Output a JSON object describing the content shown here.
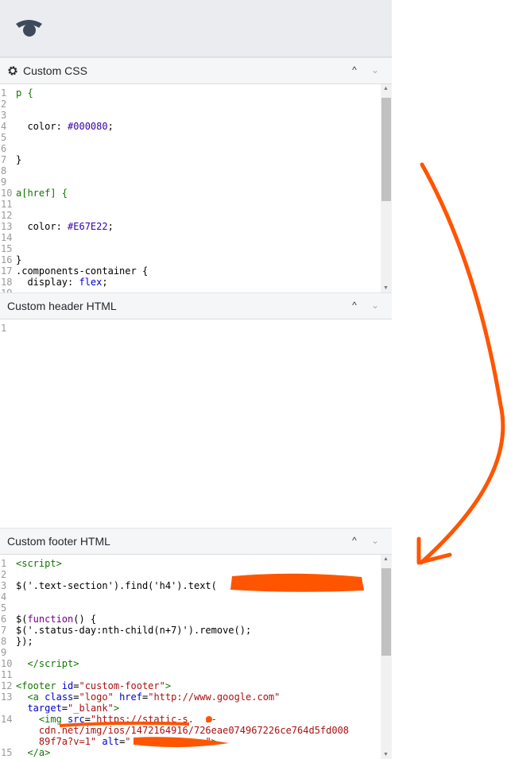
{
  "sections": [
    {
      "title": "Custom CSS",
      "icon": "gear-icon",
      "lines": [
        [
          [
            "p {",
            "t-sel"
          ]
        ],
        [],
        [],
        [
          [
            "  color: ",
            "t-prop"
          ],
          [
            "#000080",
            "t-num"
          ],
          [
            ";",
            "t-txt"
          ]
        ],
        [],
        [],
        [
          [
            "}",
            "t-txt"
          ]
        ],
        [],
        [],
        [
          [
            "a[href] {",
            "t-sel"
          ]
        ],
        [],
        [],
        [
          [
            "  color: ",
            "t-prop"
          ],
          [
            "#E67E22",
            "t-num"
          ],
          [
            ";",
            "t-txt"
          ]
        ],
        [],
        [],
        [
          [
            "}",
            "t-txt"
          ]
        ],
        [
          [
            ".components-container {",
            "t-txt"
          ]
        ],
        [
          [
            "  display: ",
            "t-prop"
          ],
          [
            "flex",
            "t-attr"
          ],
          [
            ";",
            "t-txt"
          ]
        ],
        []
      ]
    },
    {
      "title": "Custom header HTML",
      "lines": [
        []
      ]
    },
    {
      "title": "Custom footer HTML",
      "lines": [
        [
          [
            "<script>",
            "t-tag"
          ]
        ],
        [],
        [
          [
            "$('.text-section').find('h4').text(                        )",
            "t-txt"
          ]
        ],
        [],
        [],
        [
          [
            "$(",
            "t-txt"
          ],
          [
            "function",
            "t-kw"
          ],
          [
            "() {",
            "t-txt"
          ]
        ],
        [
          [
            "$('.status-day:nth-child(n+7)').remove();",
            "t-txt"
          ]
        ],
        [
          [
            "});",
            "t-txt"
          ]
        ],
        [],
        [
          [
            "  </script>",
            "t-tag"
          ]
        ],
        [],
        [
          [
            "<footer ",
            "t-tag"
          ],
          [
            "id",
            "t-attr"
          ],
          [
            "=",
            "t-txt"
          ],
          [
            "\"custom-footer\"",
            "t-str"
          ],
          [
            ">",
            "t-tag"
          ]
        ],
        [
          [
            "  <a ",
            "t-tag"
          ],
          [
            "class",
            "t-attr"
          ],
          [
            "=",
            "t-txt"
          ],
          [
            "\"logo\"",
            "t-str"
          ],
          [
            " href",
            "t-attr"
          ],
          [
            "=",
            "t-txt"
          ],
          [
            "\"http://www.google.com\"",
            "t-str"
          ],
          [
            "\n  ",
            "t-txt"
          ],
          [
            "target",
            "t-attr"
          ],
          [
            "=",
            "t-txt"
          ],
          [
            "\"_blank\"",
            "t-str"
          ],
          [
            ">",
            "t-tag"
          ]
        ],
        [
          [
            "    <img ",
            "t-tag"
          ],
          [
            "src",
            "t-attr"
          ],
          [
            "=",
            "t-txt"
          ],
          [
            "\"https://static-s.  a-\n    cdn.net/img/ios/1472164916/726eae074967226ce764d5fd008\n    89f7a?v=1\"",
            "t-str"
          ],
          [
            " alt",
            "t-attr"
          ],
          [
            "=",
            "t-txt"
          ],
          [
            "\"             \"",
            "t-str"
          ],
          [
            ">",
            "t-tag"
          ]
        ],
        [
          [
            "  </a>",
            "t-tag"
          ]
        ]
      ]
    }
  ],
  "controls": {
    "collapse": "^",
    "expand": "⌄"
  },
  "colors": {
    "annotation": "#FF5500",
    "accent": "#3d4a5c"
  }
}
